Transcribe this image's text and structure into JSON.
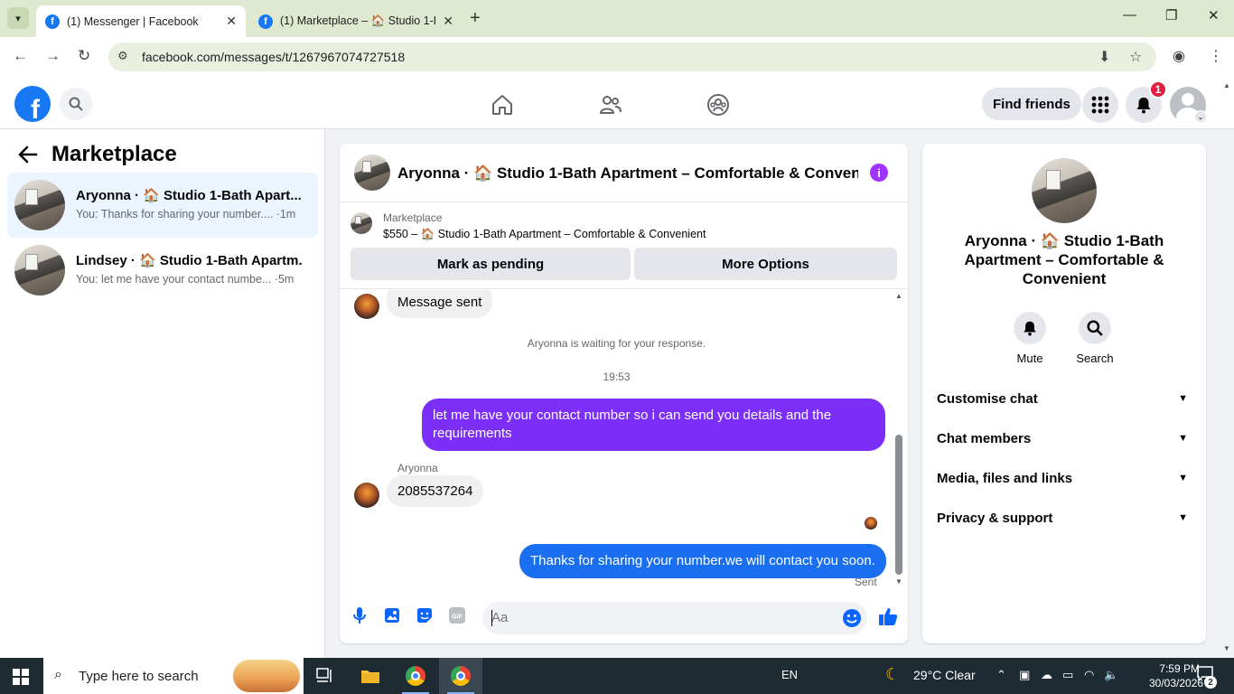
{
  "browser": {
    "tabs": [
      {
        "title": "(1) Messenger | Facebook",
        "active": true
      },
      {
        "title": "(1) Marketplace – 🏠 Studio 1-B",
        "active": false
      }
    ],
    "url": "facebook.com/messages/t/1267967074727518"
  },
  "header": {
    "find_friends": "Find friends",
    "notification_count": "1"
  },
  "sidebar": {
    "title": "Marketplace",
    "conversations": [
      {
        "name": "Aryonna · 🏠 Studio 1-Bath Apart...",
        "snippet": "You: Thanks for sharing your number.... ·1m"
      },
      {
        "name": "Lindsey · 🏠 Studio 1-Bath Apartm...",
        "snippet": "You: let me have your contact numbe... ·5m"
      }
    ]
  },
  "chat": {
    "title": "Aryonna · 🏠 Studio 1-Bath Apartment – Comfortable & Conven...",
    "marketplace_label": "Marketplace",
    "listing": "$550 – 🏠 Studio 1-Bath Apartment – Comfortable & Convenient",
    "mark_pending": "Mark as pending",
    "more_options": "More Options",
    "messages": {
      "prev_in": "Message sent",
      "waiting": "Aryonna is waiting for your response.",
      "time": "19:53",
      "out1": "let me have your contact number so i can send you details and the requirements",
      "sender": "Aryonna",
      "in1": "2085537264",
      "out2": "Thanks for sharing your number.we will contact you soon.",
      "status": "Sent"
    },
    "composer_placeholder": "Aa"
  },
  "info_panel": {
    "name": "Aryonna · 🏠 Studio 1-Bath Apartment – Comfortable & Convenient",
    "actions": {
      "mute": "Mute",
      "search": "Search"
    },
    "sections": [
      "Customise chat",
      "Chat members",
      "Media, files and links",
      "Privacy & support"
    ]
  },
  "taskbar": {
    "search_placeholder": "Type here to search",
    "language": "EN",
    "weather": "29°C  Clear",
    "time": "7:59 PM",
    "date": "30/03/2026",
    "notifications": "2"
  },
  "colors": {
    "fb_blue": "#1877f2",
    "bubble_purple": "#7b2ff7",
    "bubble_blue": "#1a6ff0",
    "info_purple": "#a033ff"
  }
}
